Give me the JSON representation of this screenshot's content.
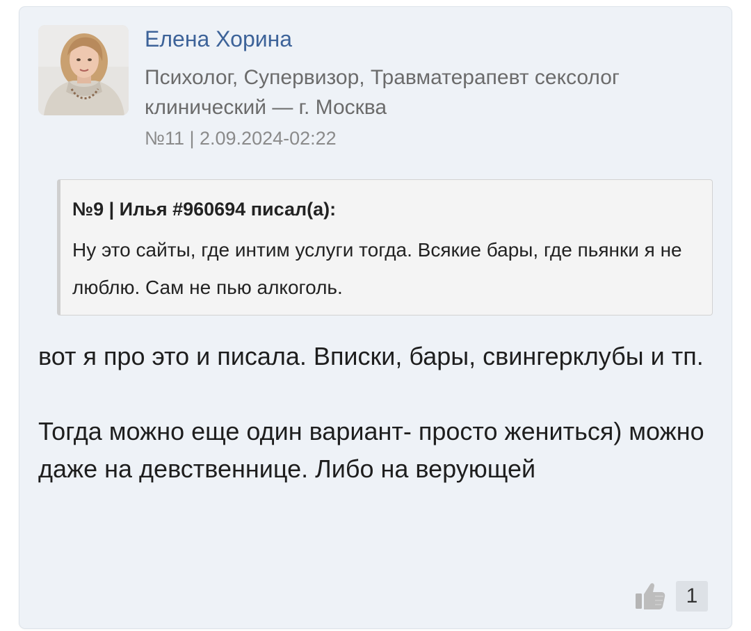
{
  "post": {
    "author": {
      "name": "Елена Хорина",
      "title": "Психолог, Супервизор, Травматерапевт сексолог клинический — г. Москва",
      "avatar_icon": "user-photo"
    },
    "meta": "№11 | 2.09.2024-02:22",
    "quote": {
      "header": "№9 | Илья #960694 писал(а):",
      "text": "Ну это сайты, где интим услуги тогда. Всякие бары, где пьянки я не люблю. Сам не пью алкоголь."
    },
    "body": {
      "paragraph1": "вот я про это и писала. Вписки, бары, свингерклубы и тп.",
      "paragraph2": "Тогда можно еще один вариант- просто жениться) можно даже на девственнице. Либо на верующей"
    },
    "likes": {
      "icon": "thumbs-up-icon",
      "count": "1"
    }
  },
  "colors": {
    "card_background": "#eef2f7",
    "author_name": "#3d6399",
    "secondary_text": "#6b6b6b",
    "quote_background": "#f4f4f4"
  }
}
